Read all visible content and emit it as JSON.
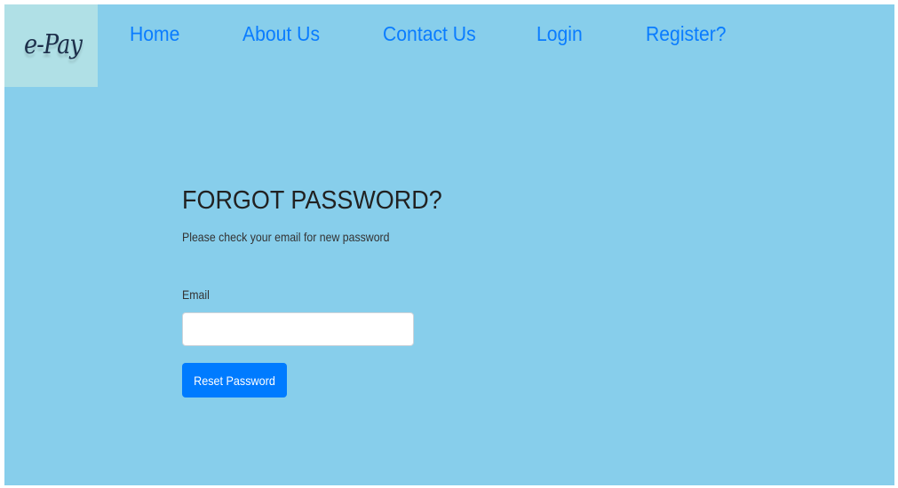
{
  "brand": {
    "logo_text": "e-Pay"
  },
  "nav": {
    "items": [
      {
        "label": "Home"
      },
      {
        "label": "About Us"
      },
      {
        "label": "Contact Us"
      },
      {
        "label": "Login"
      },
      {
        "label": "Register?"
      }
    ]
  },
  "form": {
    "title": "FORGOT PASSWORD?",
    "subtitle": "Please check your email for new password",
    "email_label": "Email",
    "email_value": "",
    "submit_label": "Reset Password"
  },
  "colors": {
    "background": "#87ceeb",
    "logo_background": "#b0e0e6",
    "link": "#0a7cff",
    "button": "#007bff",
    "button_text": "#ffffff",
    "title": "#212121"
  }
}
